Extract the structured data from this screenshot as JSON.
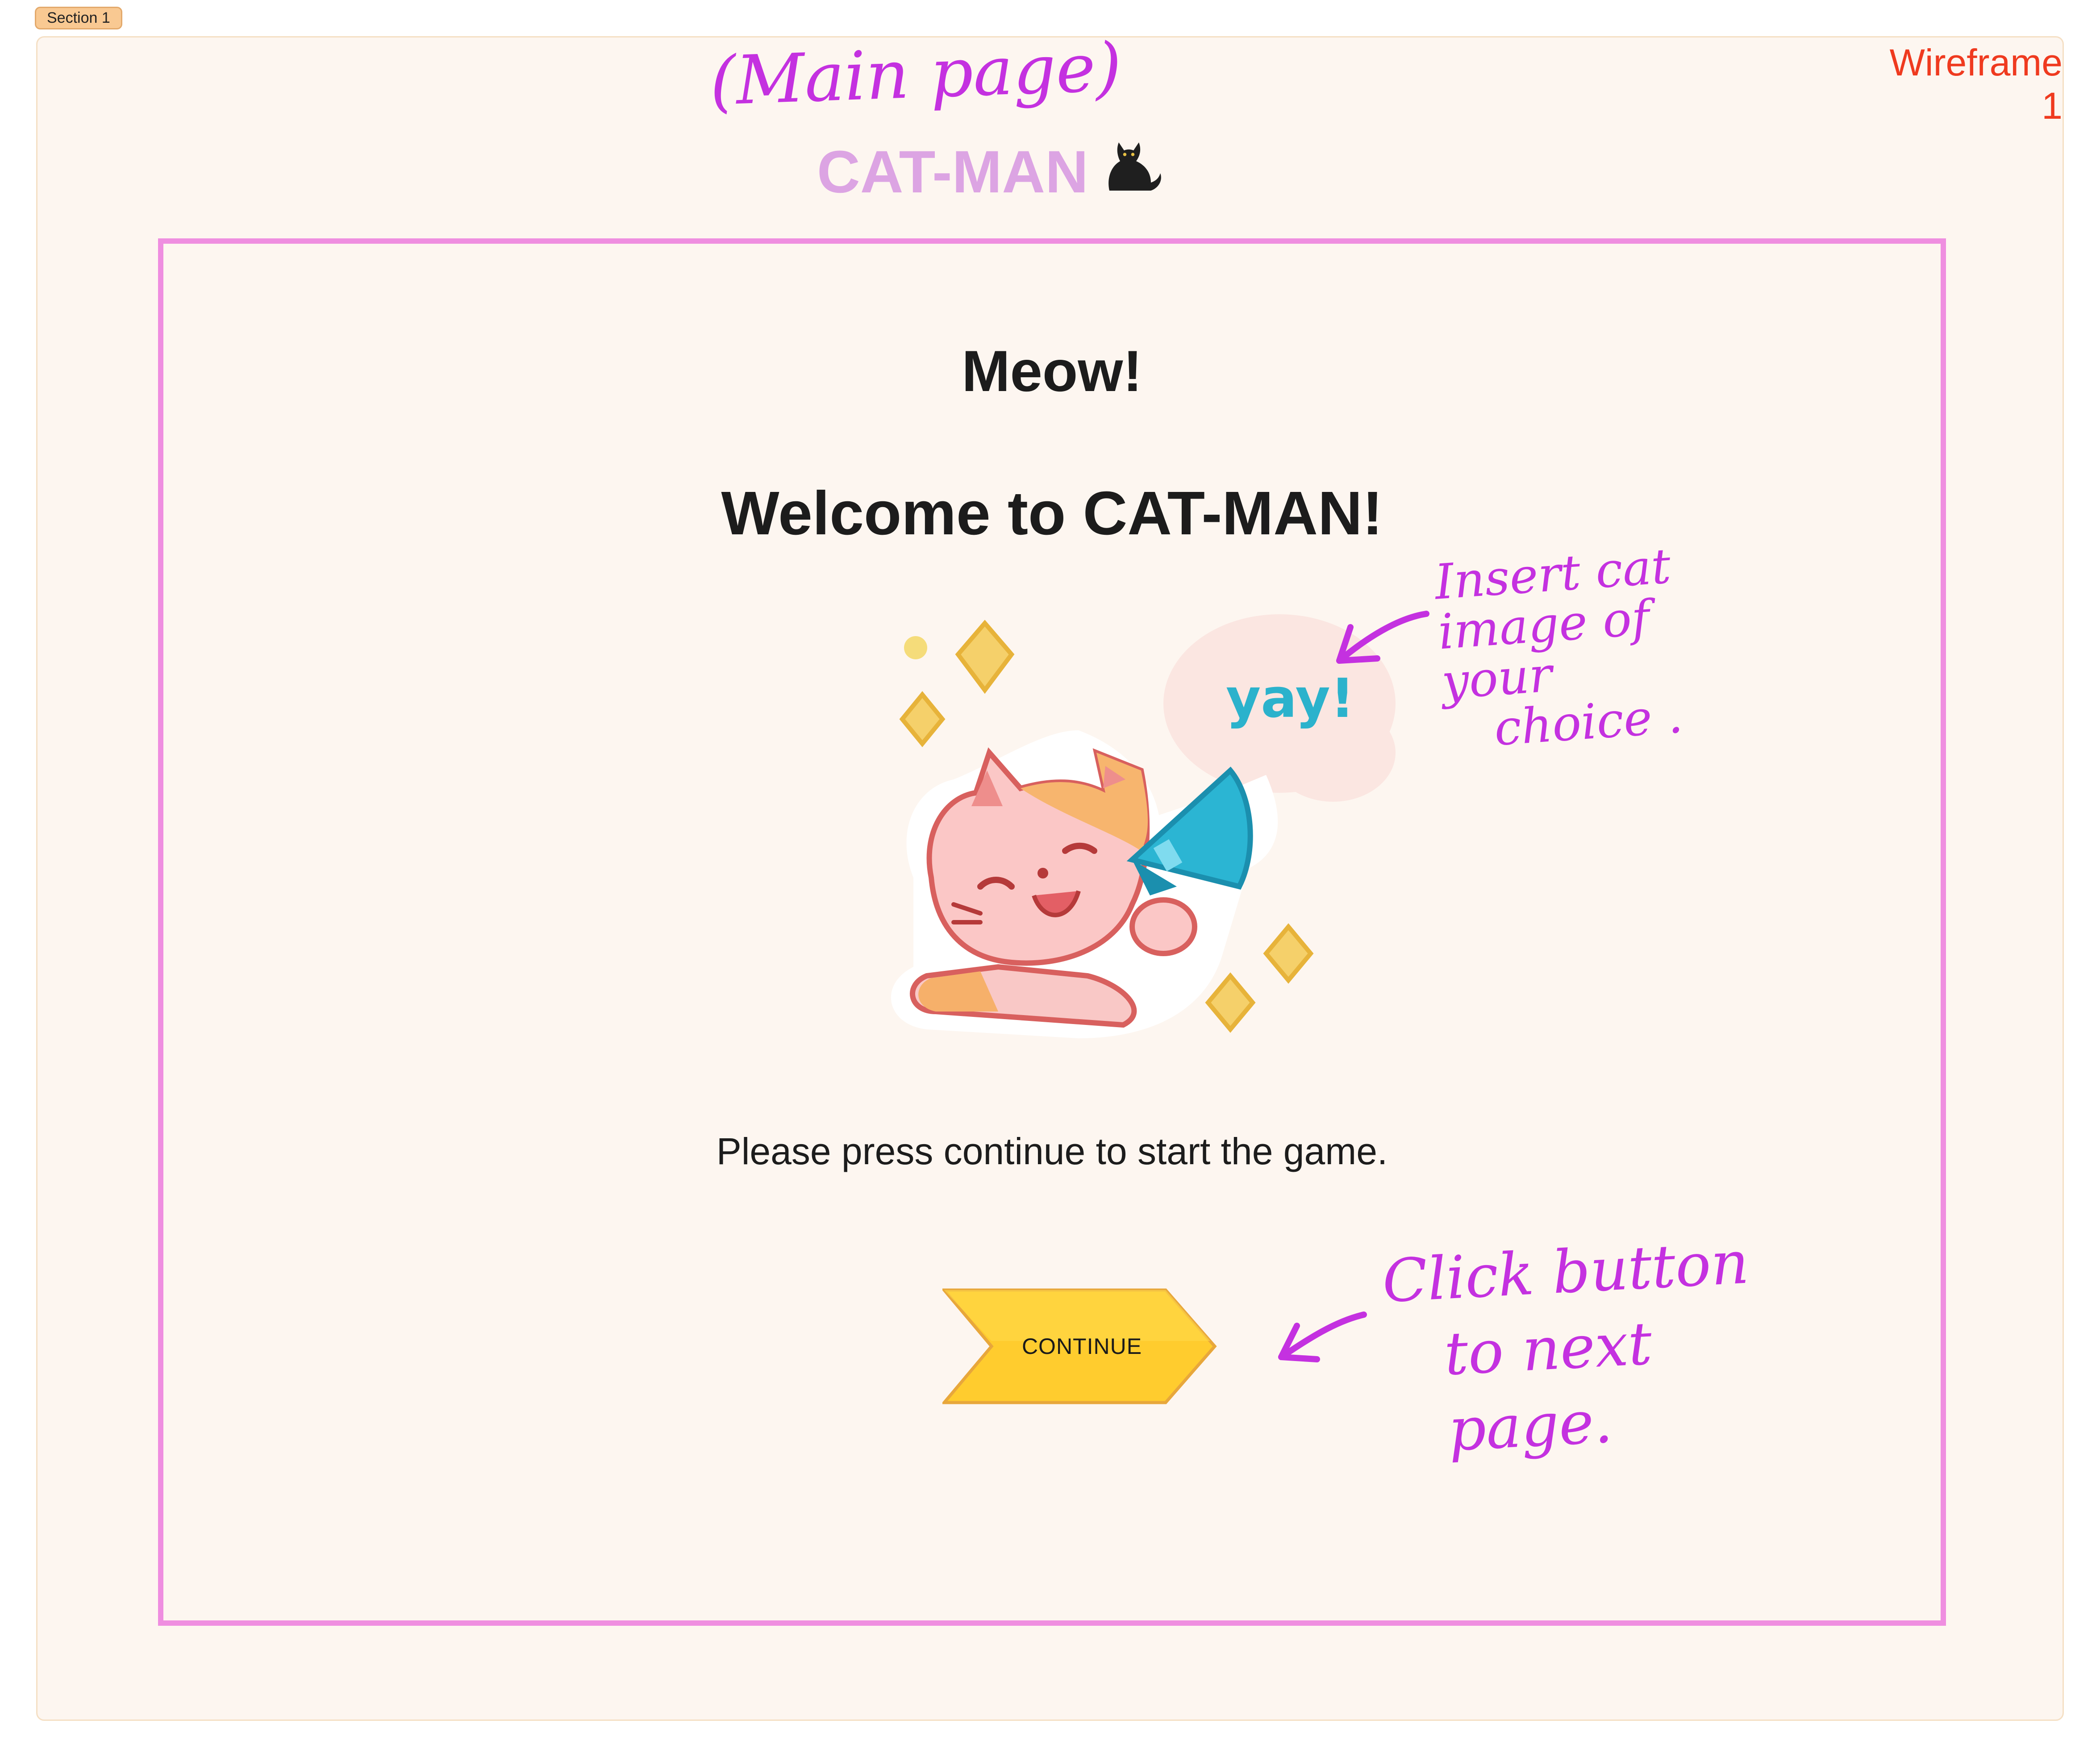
{
  "section": {
    "label": "Section 1"
  },
  "frame": {
    "label": "Wireframe 1"
  },
  "annotations": {
    "main_page": "(Main page)",
    "insert_cat_lines": [
      "Insert cat",
      "image of your",
      "choice ."
    ],
    "click_button_lines": [
      "Click button",
      "to next page."
    ]
  },
  "app": {
    "title": "CAT-MAN",
    "title_icon": "black-cat-icon",
    "title_color": "#dca4e3"
  },
  "content": {
    "greeting": "Meow!",
    "welcome": "Welcome to CAT-MAN!",
    "image_caption": "yay!",
    "instruction": "Please press continue to start the game.",
    "continue_label": "CONTINUE"
  },
  "colors": {
    "frame_border": "#ef8ee0",
    "annotation": "#c431e0",
    "wireframe_label": "#ef3a1f",
    "button_fill": "#ffcc2e"
  }
}
